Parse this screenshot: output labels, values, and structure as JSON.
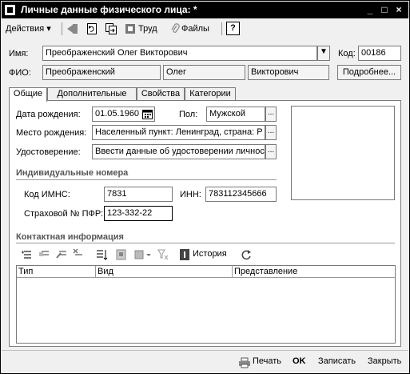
{
  "window": {
    "title": "Личные данные физического лица: *",
    "controls": [
      "_",
      "□",
      "×"
    ]
  },
  "toolbar": {
    "actions_label": "Действия",
    "labor_label": "Труд",
    "files_label": "Файлы",
    "help_label": "?"
  },
  "header": {
    "name_label": "Имя:",
    "name_value": "Преображенский Олег Викторович",
    "code_label": "Код:",
    "code_value": "00186",
    "fio_label": "ФИО:",
    "last_name": "Преображенский",
    "first_name": "Олег",
    "middle_name": "Викторович",
    "more_button": "Подробнее..."
  },
  "tabs": [
    "Общие",
    "Дополнительные",
    "Свойства",
    "Категории"
  ],
  "general": {
    "birth_date_label": "Дата рождения:",
    "birth_date_value": "01.05.1960",
    "sex_label": "Пол:",
    "sex_value": "Мужской",
    "birthplace_label": "Место рождения:",
    "birthplace_value": "Населенный пункт: Ленинград, страна: Р",
    "id_doc_label": "Удостоверение:",
    "id_doc_value": "Ввести данные об удостоверении личност",
    "individual_numbers_title": "Индивидуальные номера",
    "imns_label": "Код ИМНС:",
    "imns_value": "7831",
    "inn_label": "ИНН:",
    "inn_value": "783112345666",
    "pfr_label": "Страховой № ПФР:",
    "pfr_value": "123-332-22",
    "contact_title": "Контактная информация",
    "history_label": "История",
    "grid_columns": [
      "Тип",
      "Вид",
      "Представление"
    ]
  },
  "footer": {
    "print_label": "Печать",
    "ok_label": "OK",
    "save_label": "Записать",
    "close_label": "Закрыть"
  },
  "colors": {
    "titlebar": "#000000",
    "window_bg": "#f0f0f0",
    "field_border": "#7a7a7a",
    "section_title": "#555555"
  }
}
